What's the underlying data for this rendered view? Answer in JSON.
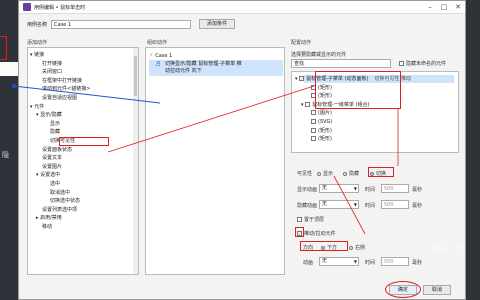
{
  "window": {
    "title": "用例编辑 • 鼠标单击时"
  },
  "top": {
    "case_label": "用例名称",
    "case_value": "Case 1",
    "add_condition": "添加条件"
  },
  "sections": {
    "add_actions": "添加动作",
    "organize_actions": "组织动作",
    "configure_actions": "配置动作"
  },
  "left_tree": [
    "链接",
    "打开链接",
    "关闭窗口",
    "在框架中打开链接",
    "滚动到元件<锚链接>",
    "设置自适应视图",
    "元件",
    "显示/隐藏",
    "显示",
    "隐藏",
    "切换可见性",
    "设置面板状态",
    "设置文本",
    "设置图片",
    "设置选中",
    "选中",
    "取消选中",
    "切换选中状态",
    "设置列表选中项",
    "启用/禁用",
    "移动"
  ],
  "organize": {
    "case": "Case 1",
    "action": "切换显示/隐藏 鼠标管理-子菜单 推动拉动元件 向下"
  },
  "config": {
    "select_label": "选择要隐藏或显示的元件",
    "hide_unnamed": "隐藏未命名的元件",
    "search_placeholder": "查找",
    "tree": [
      {
        "name": "鼠标管理-子菜单 (动态面板)",
        "note": "切换可见性 推动",
        "checked": true
      },
      {
        "name": "(矩形)",
        "note": "",
        "checked": false
      },
      {
        "name": "(矩形)",
        "note": "",
        "checked": false
      },
      {
        "name": "鼠标管理-一级菜单 (组合)",
        "note": "",
        "checked": false
      },
      {
        "name": "(图片)",
        "note": "",
        "checked": false
      },
      {
        "name": "(SVG)",
        "note": "",
        "checked": false
      },
      {
        "name": "(矩形)",
        "note": "",
        "checked": false
      },
      {
        "name": "(矩形)",
        "note": "",
        "checked": false
      }
    ],
    "visibility": {
      "label": "可见性",
      "show": "显示",
      "hide": "隐藏",
      "toggle": "切换"
    },
    "show_anim": {
      "label": "显示动画",
      "value": "无",
      "time": "时间",
      "ms_value": "500",
      "ms": "毫秒"
    },
    "hide_anim": {
      "label": "隐藏动画",
      "value": "无",
      "time": "时间",
      "ms_value": "500",
      "ms": "毫秒"
    },
    "top_layer": "置于顶层",
    "push_pull": "推动/拉动元件",
    "direction": {
      "label": "方向",
      "down": "下方",
      "right": "右侧"
    },
    "anim": {
      "label": "动画",
      "value": "无",
      "time": "时间",
      "ms_value": "500",
      "ms": "毫秒"
    }
  },
  "footer": {
    "ok": "确定",
    "cancel": "取消"
  },
  "background": {
    "left_char": "隐",
    "watermark": "知乎 @"
  },
  "colors": {
    "accent_red": "#e02020",
    "connector_blue": "#1e56c8",
    "selection": "#cfe3fb"
  }
}
